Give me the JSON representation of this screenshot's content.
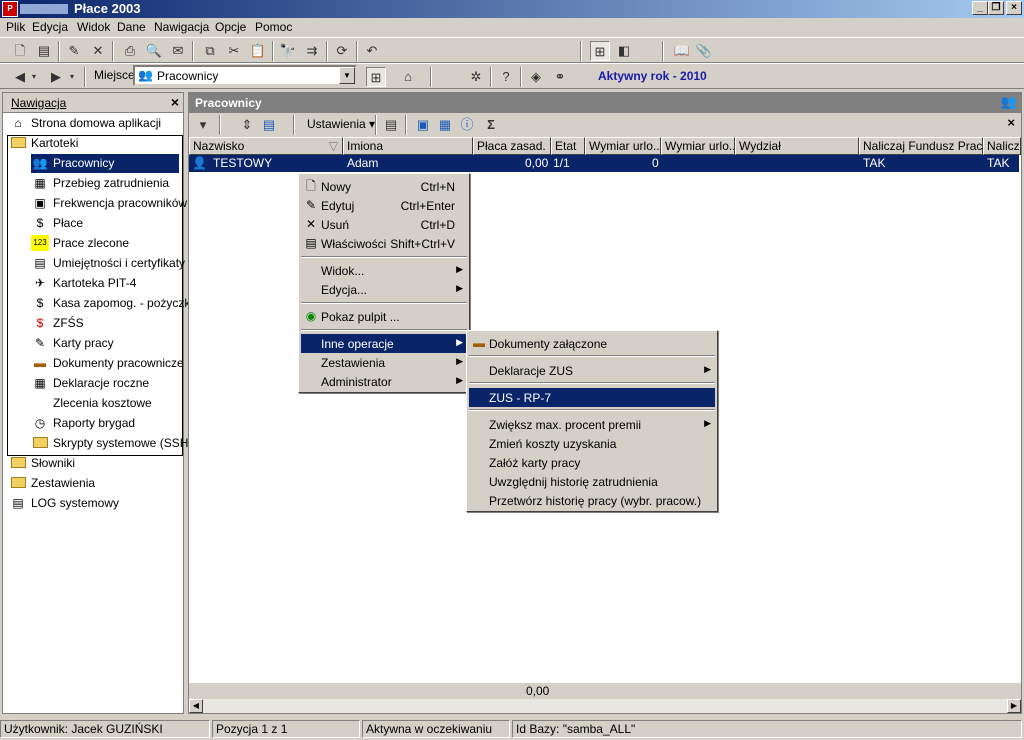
{
  "window": {
    "title": "Płace 2003"
  },
  "menubar": [
    "Plik",
    "Edycja",
    "Widok",
    "Dane",
    "Nawigacja",
    "Opcje",
    "Pomoc"
  ],
  "address": {
    "label": "Miejsce",
    "value": "Pracownicy",
    "active_year": "Aktywny rok - 2010"
  },
  "nav": {
    "title": "Nawigacja",
    "home": "Strona domowa aplikacji",
    "kartoteki": "Kartoteki",
    "kartoteki_items": [
      "Pracownicy",
      "Przebieg zatrudnienia",
      "Frekwencja pracowników",
      "Płace",
      "Prace zlecone",
      "Umiejętności i certyfikaty",
      "Kartoteka PIT-4",
      "Kasa zapomog. - pożyczk.",
      "ZFŚS",
      "Karty pracy",
      "Dokumenty pracownicze",
      "Deklaracje roczne",
      "Zlecenia kosztowe",
      "Raporty brygad",
      "Skrypty systemowe (SSH)"
    ],
    "slowniki": "Słowniki",
    "zestawienia": "Zestawienia",
    "log": "LOG systemowy"
  },
  "main": {
    "title": "Pracownicy",
    "settings_label": "Ustawienia",
    "sigma": "Σ",
    "columns": [
      "Nazwisko",
      "Imiona",
      "Płaca zasad.",
      "Etat",
      "Wymiar urlo...",
      "Wymiar urlo...",
      "Wydział",
      "Naliczaj Fundusz Pracy",
      "Nalicza"
    ],
    "row": {
      "nazwisko": "TESTOWY",
      "imiona": "Adam",
      "placa": "0,00",
      "etat": "1/1",
      "wymiar": "0",
      "fundusz": "TAK",
      "nalicza": "TAK"
    },
    "sum": "0,00"
  },
  "context_menu": {
    "nowy": "Nowy",
    "nowy_sc": "Ctrl+N",
    "edytuj": "Edytuj",
    "edytuj_sc": "Ctrl+Enter",
    "usun": "Usuń",
    "usun_sc": "Ctrl+D",
    "wlasciwosci": "Właściwości",
    "wlasciwosci_sc": "Shift+Ctrl+V",
    "widok": "Widok...",
    "edycja": "Edycja...",
    "pulpit": "Pokaz pulpit ...",
    "inne": "Inne operacje",
    "zestawienia": "Zestawienia",
    "administrator": "Administrator"
  },
  "submenu": {
    "dokumenty": "Dokumenty załączone",
    "deklaracje": "Deklaracje ZUS",
    "zus_rp7": "ZUS - RP-7",
    "zwieksz": "Zwiększ max. procent premii",
    "zmien": "Zmień koszty uzyskania",
    "zaloz": "Załóż karty pracy",
    "uwzglednij": "Uwzględnij historię zatrudnienia",
    "przetworz": "Przetwórz historię pracy (wybr. pracow.)"
  },
  "status": {
    "user": "Użytkownik: Jacek GUZIŃSKI",
    "position": "Pozycja 1 z 1",
    "state": "Aktywna w oczekiwaniu",
    "db": "Id Bazy: \"samba_ALL\""
  }
}
